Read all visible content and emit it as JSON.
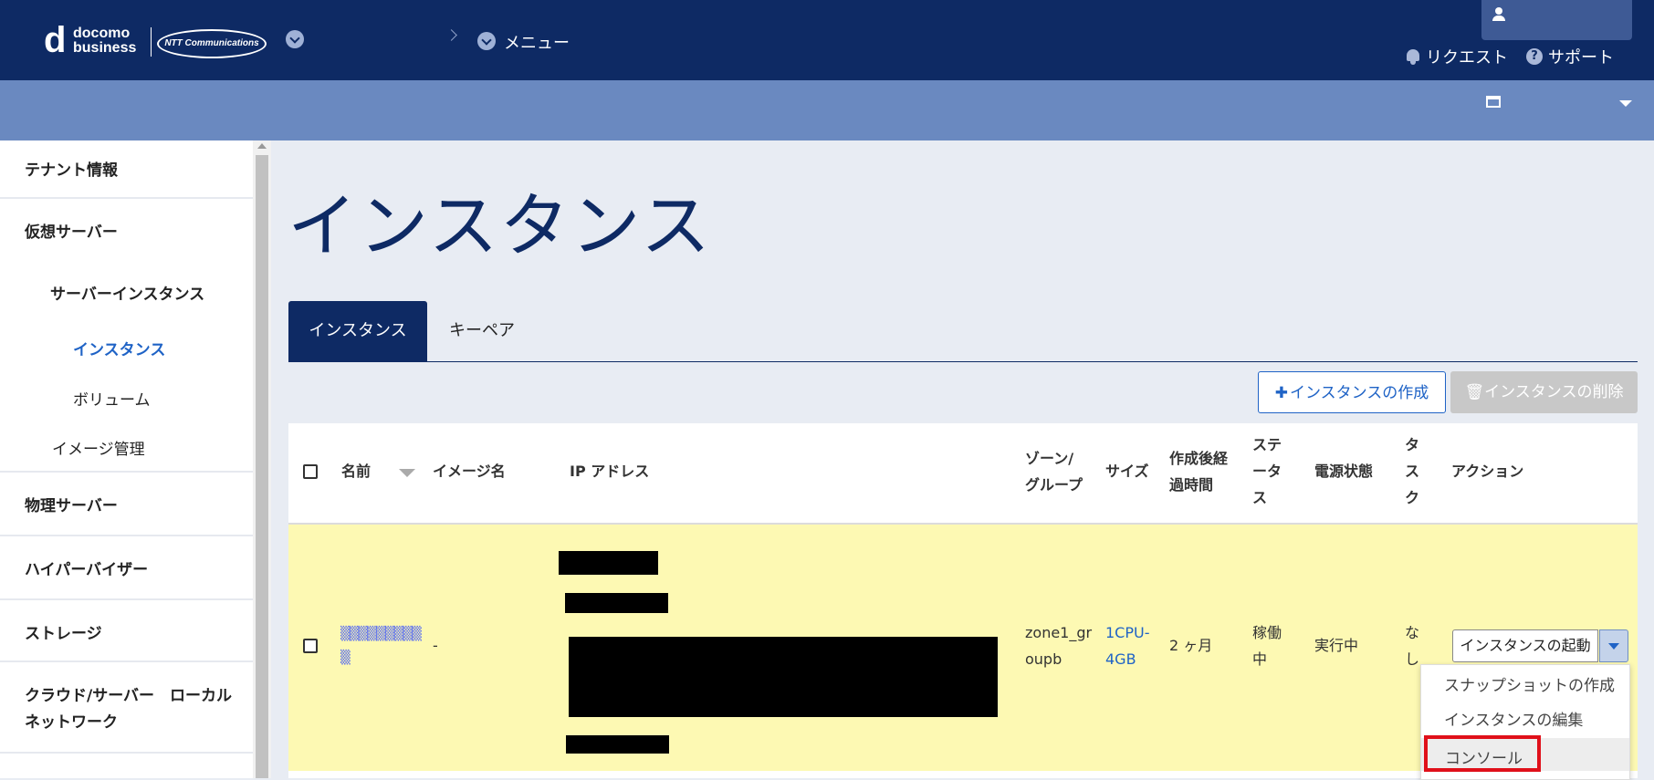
{
  "header": {
    "brand_line1": "docomo",
    "brand_line2": "business",
    "partner": "NTT Communications",
    "menu_label": "メニュー",
    "request_label": "リクエスト",
    "support_label": "サポート"
  },
  "sidebar": {
    "items": [
      {
        "label": "テナント情報"
      },
      {
        "label": "仮想サーバー"
      },
      {
        "label": "サーバーインスタンス"
      },
      {
        "label": "インスタンス",
        "active": true
      },
      {
        "label": "ボリューム"
      },
      {
        "label": "イメージ管理"
      },
      {
        "label": "物理サーバー"
      },
      {
        "label": "ハイパーバイザー"
      },
      {
        "label": "ストレージ"
      },
      {
        "label": "クラウド/サーバー　ローカル"
      },
      {
        "label": "ネットワーク"
      }
    ]
  },
  "page": {
    "title": "インスタンス"
  },
  "tabs": [
    {
      "label": "インスタンス",
      "active": true
    },
    {
      "label": "キーペア",
      "active": false
    }
  ],
  "toolbar": {
    "create_label": "インスタンスの作成",
    "delete_label": "インスタンスの削除"
  },
  "table": {
    "headers": {
      "name": "名前",
      "image": "イメージ名",
      "ip": "IP アドレス",
      "zone_l1": "ゾーン/",
      "zone_l2": "グループ",
      "size": "サイズ",
      "elapsed_l1": "作成後経",
      "elapsed_l2": "過時間",
      "status_l1": "ステ",
      "status_l2": "ータ",
      "status_l3": "ス",
      "power": "電源状態",
      "task_l1": "タ",
      "task_l2": "ス",
      "task_l3": "ク",
      "action": "アクション"
    },
    "rows": [
      {
        "image": "-",
        "zone_l1": "zone1_gr",
        "zone_l2": "oupb",
        "size_l1": "1CPU-",
        "size_l2": "4GB",
        "elapsed": "2 ヶ月",
        "status_l1": "稼働",
        "status_l2": "中",
        "power": "実行中",
        "task_l1": "な",
        "task_l2": "し",
        "action": "インスタンスの起動"
      }
    ]
  },
  "action_menu": {
    "items": [
      {
        "label": "スナップショットの作成"
      },
      {
        "label": "インスタンスの編集"
      },
      {
        "label": "コンソール",
        "highlighted": true
      }
    ]
  },
  "colors": {
    "navy": "#0e2a64",
    "secondary_bar": "#6a89c0",
    "row_highlight": "#fdf9b3",
    "link": "#1f63c6",
    "highlight_border": "#e0101a"
  }
}
